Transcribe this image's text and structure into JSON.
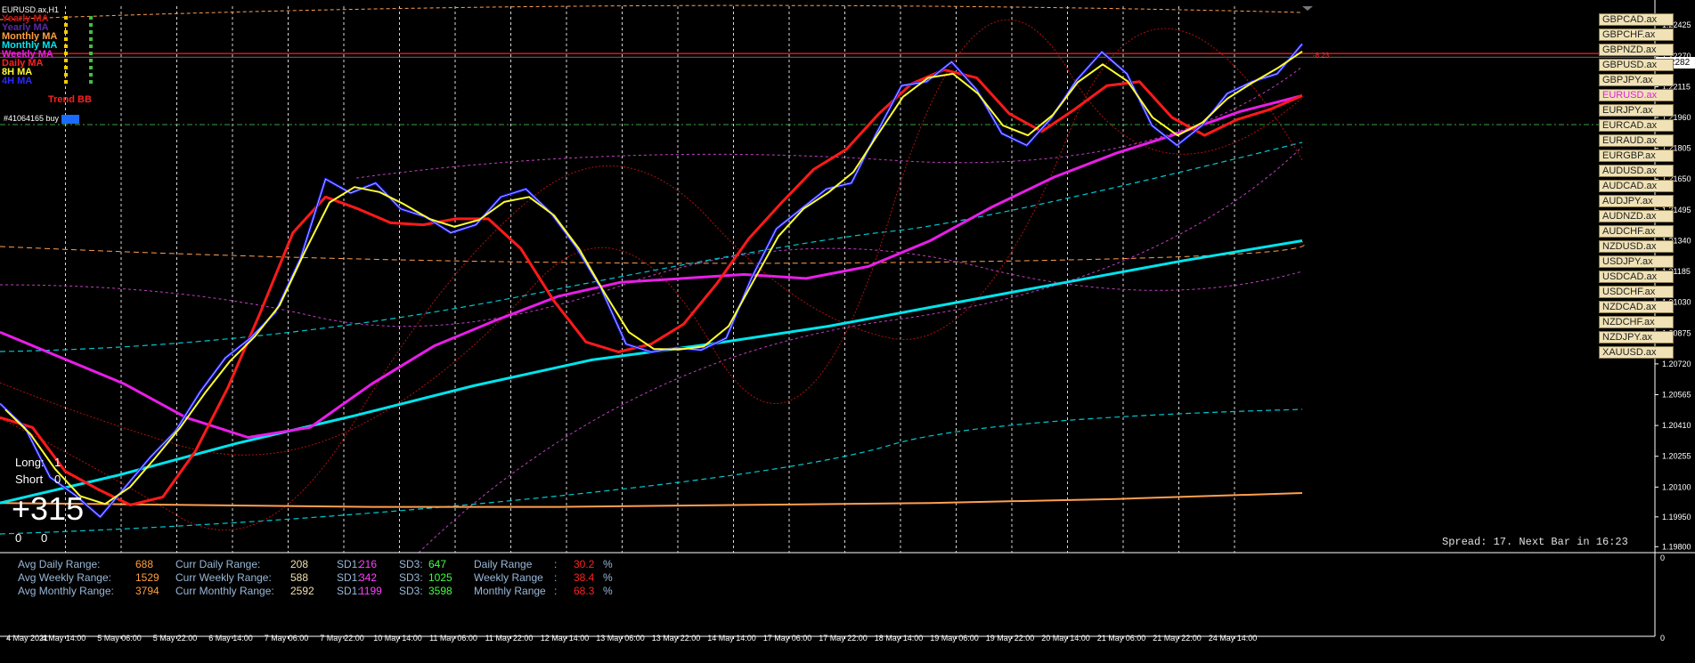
{
  "chart_data": {
    "type": "line",
    "title": "EURUSD.ax,H1",
    "x_tick_labels": [
      "4 May 2021",
      "4 May 14:00",
      "5 May 06:00",
      "5 May 22:00",
      "6 May 14:00",
      "7 May 06:00",
      "7 May 22:00",
      "10 May 14:00",
      "11 May 06:00",
      "11 May 22:00",
      "12 May 14:00",
      "13 May 06:00",
      "13 May 22:00",
      "14 May 14:00",
      "17 May 06:00",
      "17 May 22:00",
      "18 May 14:00",
      "19 May 06:00",
      "19 May 22:00",
      "20 May 14:00",
      "21 May 06:00",
      "21 May 22:00",
      "24 May 14:00"
    ],
    "y_tick_labels": [
      "1.22425",
      "1.22270",
      "1.22115",
      "1.21960",
      "1.21805",
      "1.21650",
      "1.21495",
      "1.21340",
      "1.21185",
      "1.21030",
      "1.20875",
      "1.20720",
      "1.20565",
      "1.20410",
      "1.20255",
      "1.20100",
      "1.19950",
      "1.19800"
    ],
    "ylim": [
      1.1977,
      1.2252
    ],
    "current_price": "1.22282",
    "hline_label": "-8.23",
    "price_path": [
      1.2052,
      1.204,
      1.2015,
      1.2006,
      1.1995,
      1.201,
      1.2025,
      1.2038,
      1.2058,
      1.2075,
      1.2085,
      1.2098,
      1.2125,
      1.2165,
      1.2158,
      1.2163,
      1.215,
      1.2146,
      1.2138,
      1.2142,
      1.2156,
      1.216,
      1.2148,
      1.2131,
      1.211,
      1.2082,
      1.2078,
      1.208,
      1.2079,
      1.2085,
      1.2115,
      1.214,
      1.215,
      1.216,
      1.2163,
      1.2188,
      1.2212,
      1.2214,
      1.2224,
      1.221,
      1.2188,
      1.2182,
      1.2196,
      1.2215,
      1.2229,
      1.2218,
      1.2192,
      1.2182,
      1.2192,
      1.2208,
      1.2214,
      1.2218,
      1.2233
    ],
    "series": [
      {
        "name": "Trend BB",
        "color": "#ff1a1a",
        "values": [
          1.2045,
          1.204,
          1.2018,
          1.2009,
          1.2001,
          1.2005,
          1.2028,
          1.206,
          1.2098,
          1.2138,
          1.2156,
          1.215,
          1.2143,
          1.2142,
          1.2145,
          1.2145,
          1.213,
          1.2104,
          1.2083,
          1.2078,
          1.2082,
          1.2092,
          1.2112,
          1.2135,
          1.2153,
          1.217,
          1.218,
          1.2198,
          1.2213,
          1.222,
          1.2216,
          1.2198,
          1.2189,
          1.22,
          1.2212,
          1.2214,
          1.2196,
          1.2187,
          1.2195,
          1.22,
          1.2207
        ]
      },
      {
        "name": "Weekly MA",
        "color": "#e81ee8",
        "values": [
          1.2088,
          1.2075,
          1.2062,
          1.2045,
          1.2035,
          1.204,
          1.2062,
          1.2081,
          1.2094,
          1.2106,
          1.2113,
          1.2115,
          1.2117,
          1.2115,
          1.2121,
          1.2134,
          1.2151,
          1.2166,
          1.2178,
          1.2188,
          1.2199,
          1.2207
        ]
      },
      {
        "name": "Monthly MA",
        "color": "#00e5ee",
        "values": [
          1.2002,
          1.2016,
          1.2032,
          1.2046,
          1.2061,
          1.2074,
          1.2082,
          1.2091,
          1.2102,
          1.2113,
          1.2124,
          1.2134
        ]
      },
      {
        "name": "Yearly MA",
        "color": "#ff9f50",
        "values": [
          1.2002,
          1.2001,
          1.2,
          1.2,
          1.2001,
          1.2002,
          1.2004,
          1.2007
        ]
      }
    ]
  },
  "legend": [
    {
      "label": "Yearly MA",
      "color": "#c81414"
    },
    {
      "label": "Yearly MA",
      "color": "#5a2aa8"
    },
    {
      "label": "Monthly MA",
      "color": "#ffa040"
    },
    {
      "label": "Monthly MA",
      "color": "#00e5ee"
    },
    {
      "label": "Weekly MA",
      "color": "#e81ee8"
    },
    {
      "label": "Daily MA",
      "color": "#ff2020"
    },
    {
      "label": "8H MA",
      "color": "#ffff33"
    },
    {
      "label": "4H MA",
      "color": "#2a2aff"
    }
  ],
  "trend_bb_label": "Trend BB",
  "order_label": "#41064165 buy",
  "pairs": [
    "GBPCAD.ax",
    "GBPCHF.ax",
    "GBPNZD.ax",
    "GBPUSD.ax",
    "GBPJPY.ax",
    "EURUSD.ax",
    "EURJPY.ax",
    "EURCAD.ax",
    "EURAUD.ax",
    "EURGBP.ax",
    "AUDUSD.ax",
    "AUDCAD.ax",
    "AUDJPY.ax",
    "AUDNZD.ax",
    "AUDCHF.ax",
    "NZDUSD.ax",
    "USDJPY.ax",
    "USDCAD.ax",
    "USDCHF.ax",
    "NZDCAD.ax",
    "NZDCHF.ax",
    "NZDJPY.ax",
    "XAUUSD.ax"
  ],
  "active_pair": "EURUSD.ax",
  "position": {
    "long_label": "Long:",
    "short_label": "Short",
    "long_value": "1",
    "short_value": "0",
    "profit": "+315",
    "left_zero": "0",
    "right_zero": "0"
  },
  "spread_text": "Spread: 17. Next Bar in 16:23",
  "stats": {
    "avg_daily_label": "Avg Daily Range:",
    "avg_daily": "688",
    "avg_weekly_label": "Avg Weekly Range:",
    "avg_weekly": "1529",
    "avg_monthly_label": "Avg Monthly Range:",
    "avg_monthly": "3794",
    "curr_daily_label": "Curr Daily Range:",
    "curr_daily": "208",
    "curr_weekly_label": "Curr Weekly Range:",
    "curr_weekly": "588",
    "curr_monthly_label": "Curr Monthly Range:",
    "curr_monthly": "2592",
    "sd1_label": "SD1:",
    "sd1_daily": "216",
    "sd1_weekly": "342",
    "sd1_monthly": "1199",
    "sd3_label": "SD3:",
    "sd3_daily": "647",
    "sd3_weekly": "1025",
    "sd3_monthly": "3598",
    "daily_range_label": "Daily Range",
    "weekly_range_label": "Weekly Range",
    "monthly_range_label": "Monthly Range",
    "colon": ":",
    "pct_daily": "30.2",
    "pct_weekly": "38.4",
    "pct_monthly": "68.3",
    "pct_sign": "%"
  },
  "subwindow": {
    "top_label": "0",
    "bottom_label": "0"
  },
  "colors": {
    "background": "#000000",
    "grid": "#d8d8d8",
    "price_line": "#d0d0d0",
    "ma_fast": "#ffff33",
    "ma_4h": "#1a1aff",
    "envelope": "#00c8d0",
    "band_magenta": "#c040c0",
    "band_red": "#b01010",
    "yearly_band": "#ff9f50",
    "current_price_line": "#ff2020",
    "order_line": "#3aa040",
    "stats_label": "#9ab8d8",
    "orange": "#ffa040",
    "green": "#40ff40",
    "magenta": "#ff40ff",
    "red": "#ff2020",
    "cream": "#f0e0b0"
  }
}
